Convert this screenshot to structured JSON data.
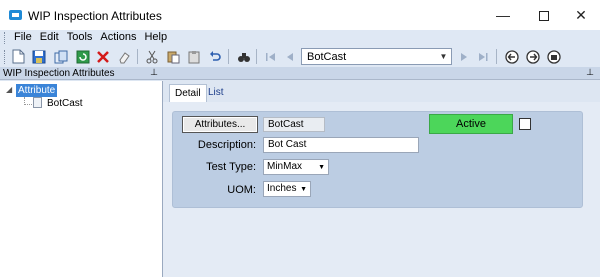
{
  "window": {
    "title": "WIP Inspection Attributes"
  },
  "menu": [
    "File",
    "Edit",
    "Tools",
    "Actions",
    "Help"
  ],
  "toolbar": {
    "combo_value": "BotCast",
    "icons": [
      "new-icon",
      "save-icon",
      "copy-icon",
      "refresh-icon",
      "delete-icon",
      "eraser-icon",
      "cut-icon",
      "paste-icon",
      "clipboard-icon",
      "undo-icon",
      "binoculars-icon",
      "first-record-icon",
      "prev-record-icon",
      "next-record-icon",
      "last-record-icon",
      "back-icon",
      "forward-icon",
      "home-icon"
    ]
  },
  "left_pane": {
    "title": "WIP Inspection Attributes",
    "tree": {
      "root": "Attribute",
      "child": "BotCast"
    }
  },
  "tabs": [
    "Detail",
    "List"
  ],
  "form": {
    "attributes_button": "Attributes...",
    "attribute_value": "BotCast",
    "status": "Active",
    "description_label": "Description:",
    "description_value": "Bot Cast",
    "test_type_label": "Test Type:",
    "test_type_value": "MinMax",
    "uom_label": "UOM:",
    "uom_value": "Inches"
  },
  "colors": {
    "active": "#4cd65a",
    "selection": "#3a84d8",
    "panel": "#bccde3"
  }
}
